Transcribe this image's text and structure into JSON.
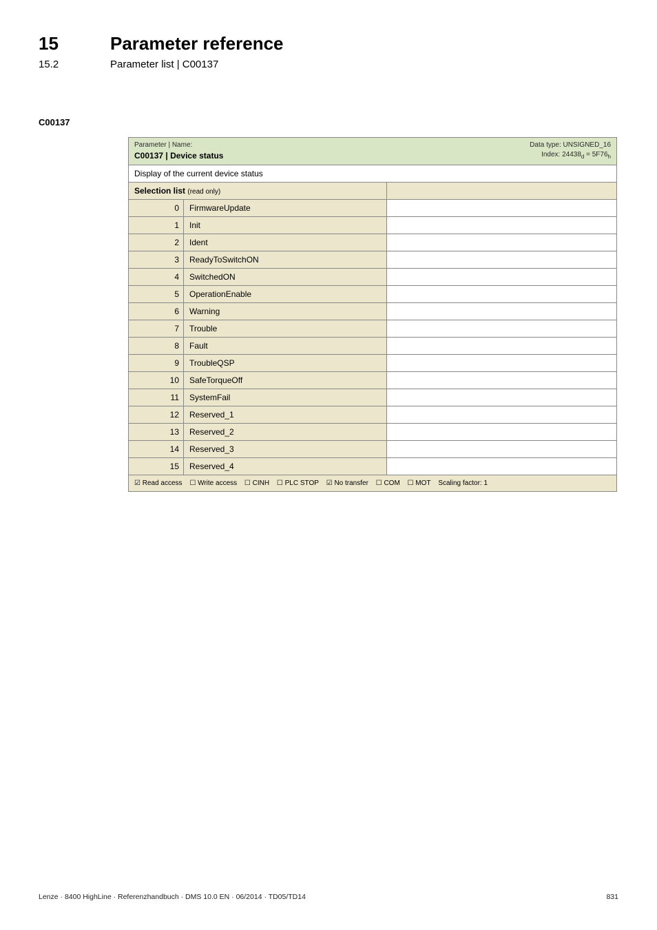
{
  "header": {
    "chapter_num": "15",
    "chapter_title": "Parameter reference",
    "sub_num": "15.2",
    "sub_title": "Parameter list | C00137"
  },
  "dash_rule": "_ _ _ _ _ _ _ _ _ _ _ _ _ _ _ _ _ _ _ _ _ _ _ _ _ _ _ _ _ _ _ _ _ _ _ _ _ _ _ _ _ _ _ _ _ _ _ _ _ _ _ _ _ _ _ _ _ _ _ _ _ _ _ _",
  "param_id": "C00137",
  "param_table": {
    "header_label": "Parameter | Name:",
    "header_name_code": "C00137",
    "header_name_sep": " | ",
    "header_name_title": "Device status",
    "data_type": "Data type: UNSIGNED_16",
    "index_prefix": "Index: 24438",
    "index_sub1": "d",
    "index_mid": " = 5F76",
    "index_sub2": "h",
    "description": "Display of the current device status",
    "selection_label": "Selection list",
    "selection_ro": "(read only)",
    "rows": [
      {
        "code": "0",
        "label": "FirmwareUpdate"
      },
      {
        "code": "1",
        "label": "Init"
      },
      {
        "code": "2",
        "label": "Ident"
      },
      {
        "code": "3",
        "label": "ReadyToSwitchON"
      },
      {
        "code": "4",
        "label": "SwitchedON"
      },
      {
        "code": "5",
        "label": "OperationEnable"
      },
      {
        "code": "6",
        "label": "Warning"
      },
      {
        "code": "7",
        "label": "Trouble"
      },
      {
        "code": "8",
        "label": "Fault"
      },
      {
        "code": "9",
        "label": "TroubleQSP"
      },
      {
        "code": "10",
        "label": "SafeTorqueOff"
      },
      {
        "code": "11",
        "label": "SystemFail"
      },
      {
        "code": "12",
        "label": "Reserved_1"
      },
      {
        "code": "13",
        "label": "Reserved_2"
      },
      {
        "code": "14",
        "label": "Reserved_3"
      },
      {
        "code": "15",
        "label": "Reserved_4"
      }
    ],
    "footer": {
      "read_access": "☑ Read access",
      "write_access": "☐ Write access",
      "cinh": "☐ CINH",
      "plc_stop": "☐ PLC STOP",
      "no_transfer": "☑ No transfer",
      "com": "☐ COM",
      "mot": "☐ MOT",
      "scaling": "Scaling factor: 1"
    }
  },
  "page_footer": {
    "left": "Lenze · 8400 HighLine · Referenzhandbuch · DMS 10.0 EN · 06/2014 · TD05/TD14",
    "right": "831"
  }
}
